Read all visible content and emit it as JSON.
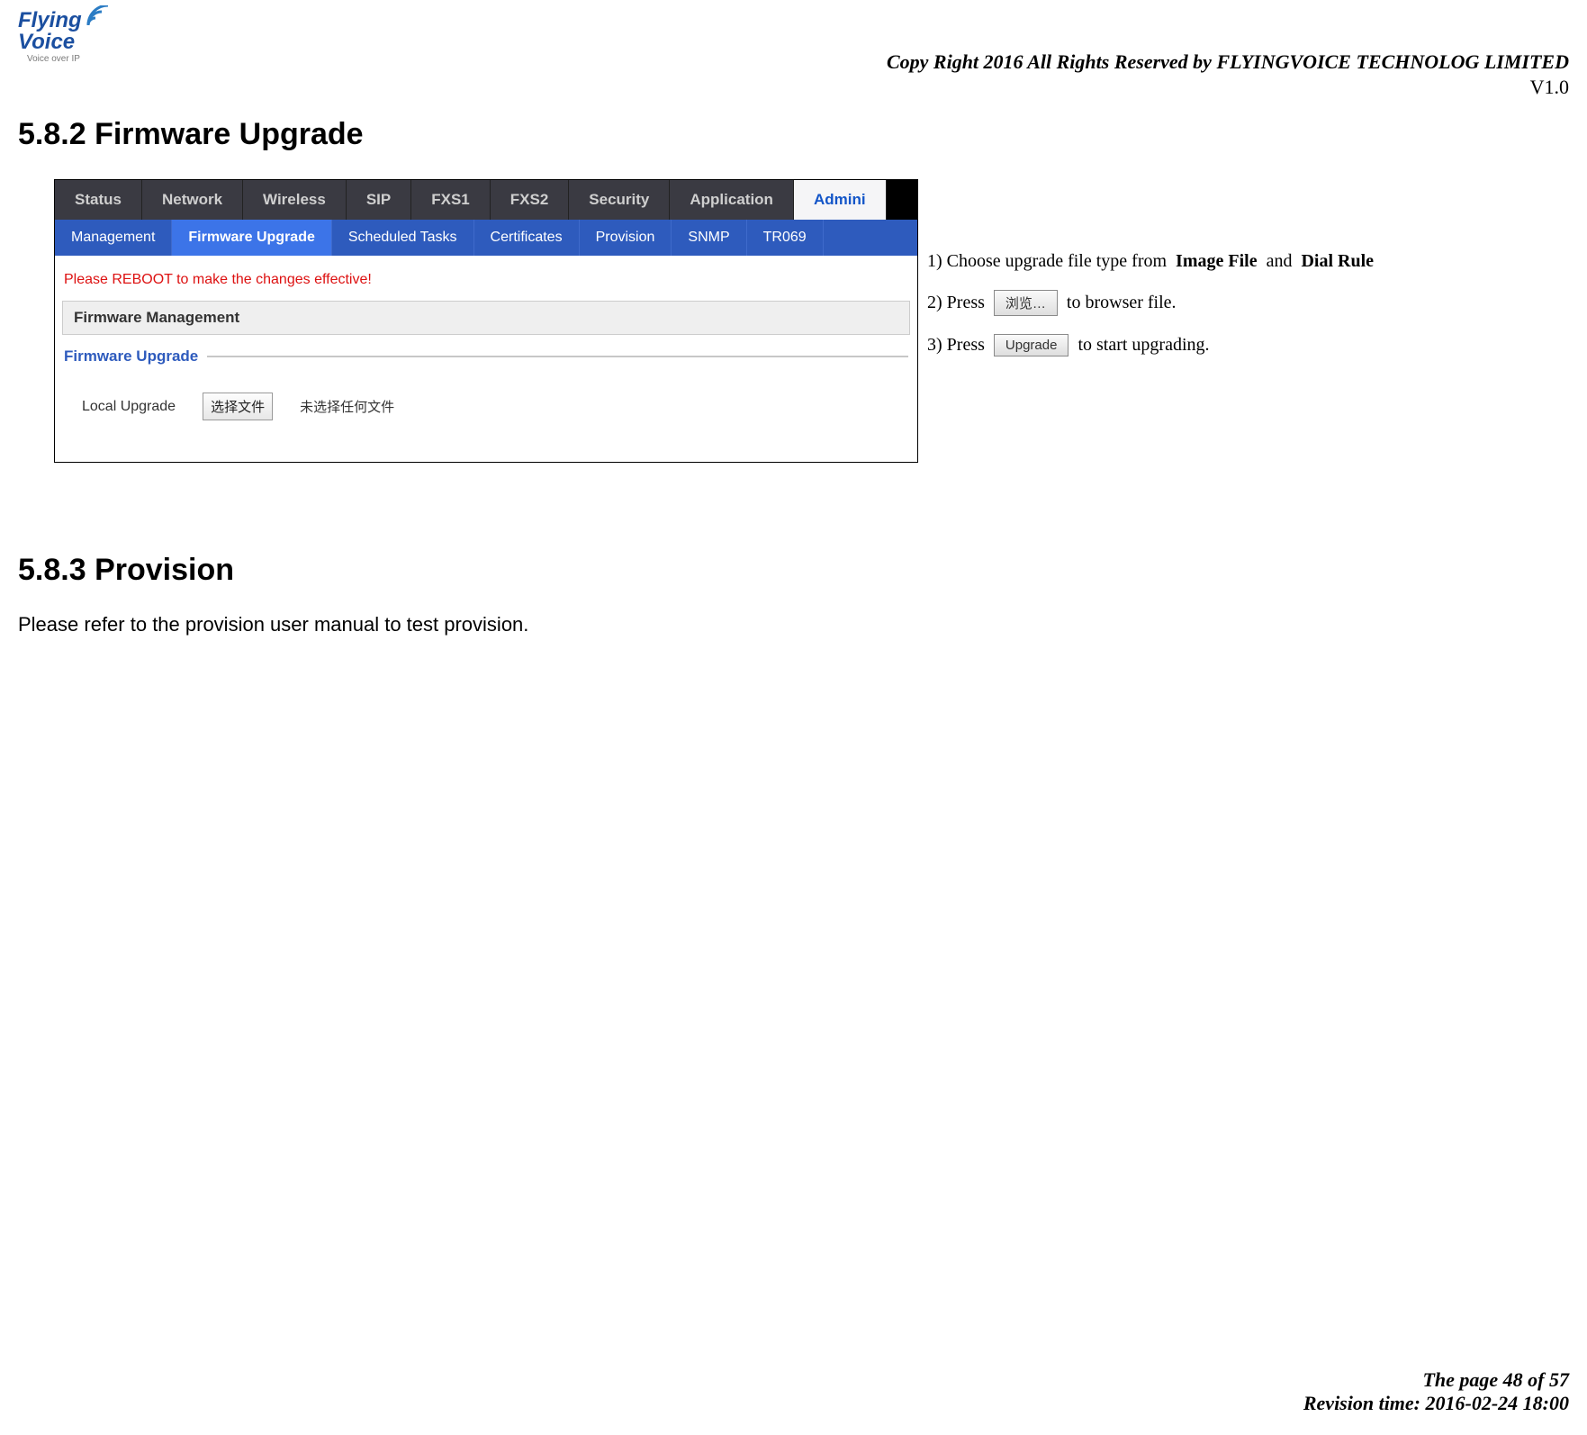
{
  "logo": {
    "brand_top": "Flying",
    "brand_bottom": "Voice",
    "tagline": "Voice over IP"
  },
  "header": {
    "copyright": "Copy Right 2016 All Rights Reserved by FLYINGVOICE TECHNOLOG LIMITED",
    "version": "V1.0"
  },
  "section582": {
    "heading": "5.8.2 Firmware Upgrade"
  },
  "screenshot": {
    "top_tabs": [
      "Status",
      "Network",
      "Wireless",
      "SIP",
      "FXS1",
      "FXS2",
      "Security",
      "Application",
      "Admini"
    ],
    "top_active_index": 8,
    "sub_tabs": [
      "Management",
      "Firmware Upgrade",
      "Scheduled Tasks",
      "Certificates",
      "Provision",
      "SNMP",
      "TR069"
    ],
    "sub_active_index": 1,
    "reboot_notice": "Please REBOOT to make the changes effective!",
    "panel_title": "Firmware Management",
    "section_title": "Firmware Upgrade",
    "local_upgrade_label": "Local Upgrade",
    "choose_file_btn": "选择文件",
    "no_file_text": "未选择任何文件"
  },
  "instructions": {
    "step1_prefix": "1) Choose upgrade file type from ",
    "step1_opt1": "Image File",
    "step1_and": " and ",
    "step1_opt2": "Dial Rule",
    "step2_prefix": "2) Press ",
    "browse_btn": "浏览…",
    "step2_suffix": " to browser file.",
    "step3_prefix": "3) Press ",
    "upgrade_btn": "Upgrade",
    "step3_suffix": " to start upgrading."
  },
  "section583": {
    "heading": "5.8.3 Provision",
    "body": "Please refer to the provision user manual to test provision."
  },
  "footer": {
    "page": "The page 48 of 57",
    "revision": "Revision time: 2016-02-24 18:00"
  }
}
